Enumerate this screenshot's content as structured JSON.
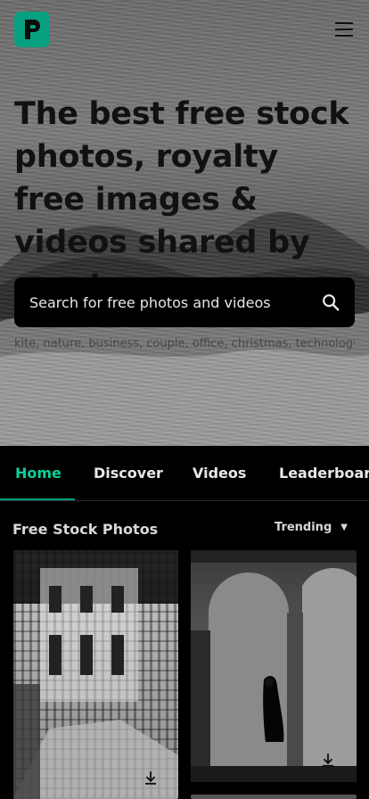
{
  "header": {
    "logo_icon": "pexels-logo-icon",
    "menu_icon": "hamburger-menu-icon",
    "brand_color": "#07a081"
  },
  "hero": {
    "title": "The best free stock photos, royalty free images & videos shared by creators.",
    "search_placeholder": "Search for free photos and videos",
    "trending_text": "kite, nature, business, couple, office, christmas, technology"
  },
  "tabs": [
    {
      "label": "Home",
      "active": true
    },
    {
      "label": "Discover",
      "active": false
    },
    {
      "label": "Videos",
      "active": false
    },
    {
      "label": "Leaderboard",
      "active": false
    }
  ],
  "section": {
    "title": "Free Stock Photos",
    "sort_label": "Trending"
  },
  "photos": [
    {
      "subject": "building facade with stairs",
      "download_icon": "download-icon"
    },
    {
      "subject": "person walking under arches",
      "download_icon": "download-icon"
    }
  ]
}
